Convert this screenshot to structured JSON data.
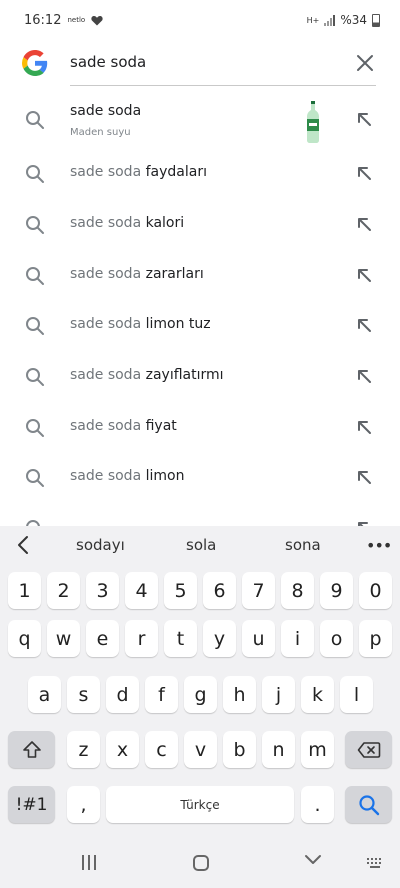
{
  "status_bar": {
    "time": "16:12",
    "app_indicator": "netlo",
    "network": "H+",
    "battery": "%34"
  },
  "search": {
    "query": "sade soda",
    "clear_icon": "close-icon",
    "logo": "google-logo"
  },
  "suggestions": [
    {
      "base": "sade soda",
      "tail": "",
      "sub": "Maden suyu",
      "has_image": true
    },
    {
      "base": "sade soda",
      "tail": " faydaları"
    },
    {
      "base": "sade soda",
      "tail": " kalori"
    },
    {
      "base": "sade soda",
      "tail": " zararları"
    },
    {
      "base": "sade soda",
      "tail": " limon tuz"
    },
    {
      "base": "sade soda",
      "tail": " zayıflatırmı"
    },
    {
      "base": "sade soda",
      "tail": " fiyat"
    },
    {
      "base": "sade soda",
      "tail": " limon"
    }
  ],
  "keyboard": {
    "predictions": [
      "sodayı",
      "sola",
      "sona"
    ],
    "more": "•••",
    "rows": [
      [
        "1",
        "2",
        "3",
        "4",
        "5",
        "6",
        "7",
        "8",
        "9",
        "0"
      ],
      [
        "q",
        "w",
        "e",
        "r",
        "t",
        "y",
        "u",
        "i",
        "o",
        "p"
      ],
      [
        "a",
        "s",
        "d",
        "f",
        "g",
        "h",
        "j",
        "k",
        "l"
      ],
      [
        "z",
        "x",
        "c",
        "v",
        "b",
        "n",
        "m"
      ]
    ],
    "symbols_label": "!#1",
    "comma": ",",
    "space_label": "Türkçe",
    "period": "."
  }
}
